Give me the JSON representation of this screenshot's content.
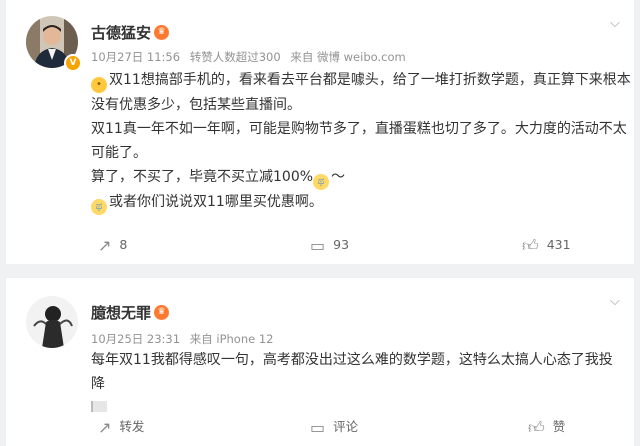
{
  "posts": [
    {
      "author": "古德猛安",
      "badge_icon": "gold-vip-icon",
      "time": "10月27日 11:56",
      "reposts_info": "转赞人数超过300",
      "source": "来自 微博 weibo.com",
      "paragraphs": [
        "双11想搞部手机的，看来看去平台都是噱头，给了一堆打折数学题，真正算下来根本没有优惠多少，包括某些直播间。",
        "双11真一年不如一年啊，可能是购物节多了，直播蛋糕也切了多了。大力度的活动不太可能了。",
        "算了，不买了，毕竟不买立减100%",
        "～",
        "或者你们说说双11哪里买优惠啊。"
      ],
      "actions": {
        "repost": "8",
        "comment": "93",
        "like": "431"
      }
    },
    {
      "author": "臆想无罪",
      "badge_icon": "gold-vip-icon",
      "time": "10月25日 23:31",
      "source": "来自 iPhone 12",
      "text": "每年双11我都得感叹一句，高考都没出过这么难的数学题，这特么太搞人心态了我投降",
      "actions": {
        "repost": "转发",
        "comment": "评论",
        "like": "赞"
      }
    }
  ],
  "colors": {
    "accent": "#ff8200",
    "meta": "#939393",
    "text": "#333333",
    "page_bg": "#f0f1f3"
  }
}
